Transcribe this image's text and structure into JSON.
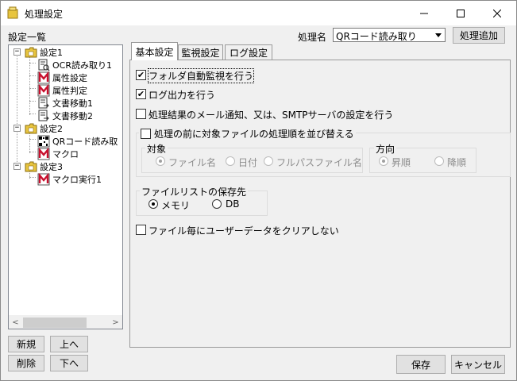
{
  "window": {
    "title": "処理設定",
    "minimize": "—",
    "maximize": "☐",
    "close": "✕"
  },
  "left": {
    "list_label": "設定一覧",
    "tree": [
      {
        "label": "設定1",
        "type": "folder",
        "expanded": true,
        "toggle": "−"
      },
      {
        "label": "OCR読み取り1",
        "type": "ocr"
      },
      {
        "label": "属性設定",
        "type": "macro"
      },
      {
        "label": "属性判定",
        "type": "macro"
      },
      {
        "label": "文書移動1",
        "type": "doc"
      },
      {
        "label": "文書移動2",
        "type": "doc"
      },
      {
        "label": "設定2",
        "type": "folder",
        "expanded": true,
        "toggle": "−"
      },
      {
        "label": "QRコード読み取",
        "type": "qr"
      },
      {
        "label": "マクロ",
        "type": "macro"
      },
      {
        "label": "設定3",
        "type": "folder",
        "expanded": true,
        "toggle": "−"
      },
      {
        "label": "マクロ実行1",
        "type": "macro"
      }
    ],
    "scroll_left": "<",
    "scroll_right": ">",
    "buttons": {
      "new": "新規",
      "up": "上へ",
      "delete": "削除",
      "down": "下へ"
    }
  },
  "header": {
    "process_name_label": "処理名",
    "process_name_value": "QRコード読み取り",
    "add_process_button": "処理追加"
  },
  "tabs": [
    {
      "label": "基本設定",
      "active": true
    },
    {
      "label": "監視設定",
      "active": false
    },
    {
      "label": "ログ設定",
      "active": false
    }
  ],
  "basic": {
    "auto_monitor": {
      "label": "フォルダ自動監視を行う",
      "checked": true,
      "mark": "✔"
    },
    "log_output": {
      "label": "ログ出力を行う",
      "checked": true,
      "mark": "✔"
    },
    "mail_notify": {
      "label": "処理結果のメール通知、又は、SMTPサーバの設定を行う",
      "checked": false
    },
    "sort_before": {
      "label": "処理の前に対象ファイルの処理順を並び替える",
      "checked": false
    },
    "target_group": {
      "title": "対象",
      "options": [
        "ファイル名",
        "日付",
        "フルパスファイル名"
      ],
      "selected": "ファイル名"
    },
    "direction_group": {
      "title": "方向",
      "options": [
        "昇順",
        "降順"
      ],
      "selected": "昇順"
    },
    "storage_group": {
      "title": "ファイルリストの保存先",
      "options": [
        "メモリ",
        "DB"
      ],
      "selected": "メモリ"
    },
    "no_clear": {
      "label": "ファイル毎にユーザーデータをクリアしない",
      "checked": false
    }
  },
  "footer": {
    "save": "保存",
    "cancel": "キャンセル"
  },
  "colors": {
    "folder": "#e8c53f",
    "macro_red": "#c8102e"
  }
}
